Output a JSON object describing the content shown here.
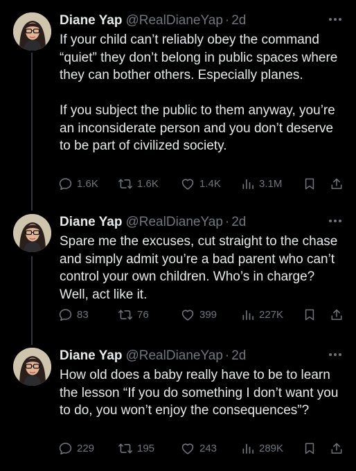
{
  "colors": {
    "background": "#000000",
    "text": "#e7e9ea",
    "muted": "#71767b",
    "thread_line": "#333639"
  },
  "tweets": [
    {
      "name": "Diane Yap",
      "handle": "@RealDianeYap",
      "separator": "·",
      "time": "2d",
      "text": "If your child can’t reliably obey the command “quiet” they don’t belong in public spaces where they can bother others. Especially planes.\n\nIf you subject the public to them anyway, you’re an inconsiderate person and you don’t deserve to be part of civilized society.",
      "replies": "1.6K",
      "reposts": "1.6K",
      "likes": "1.4K",
      "views": "3.1M"
    },
    {
      "name": "Diane Yap",
      "handle": "@RealDianeYap",
      "separator": "·",
      "time": "2d",
      "text": "Spare me the excuses, cut straight to the chase and simply admit you’re a bad parent who can’t control your own children. Who’s in charge? Well, act like it.",
      "replies": "83",
      "reposts": "76",
      "likes": "399",
      "views": "227K"
    },
    {
      "name": "Diane Yap",
      "handle": "@RealDianeYap",
      "separator": "·",
      "time": "2d",
      "text": "How old does a baby really have to be to learn the lesson “If you do something I don’t want you to do, you won’t enjoy the consequences”?",
      "replies": "229",
      "reposts": "195",
      "likes": "243",
      "views": "289K"
    }
  ],
  "icons": {
    "more": "more-horizontal-icon",
    "reply": "reply-bubble-icon",
    "repost": "repost-arrows-icon",
    "like": "heart-icon",
    "views": "views-bar-chart-icon",
    "bookmark": "bookmark-icon",
    "share": "share-upload-icon"
  }
}
